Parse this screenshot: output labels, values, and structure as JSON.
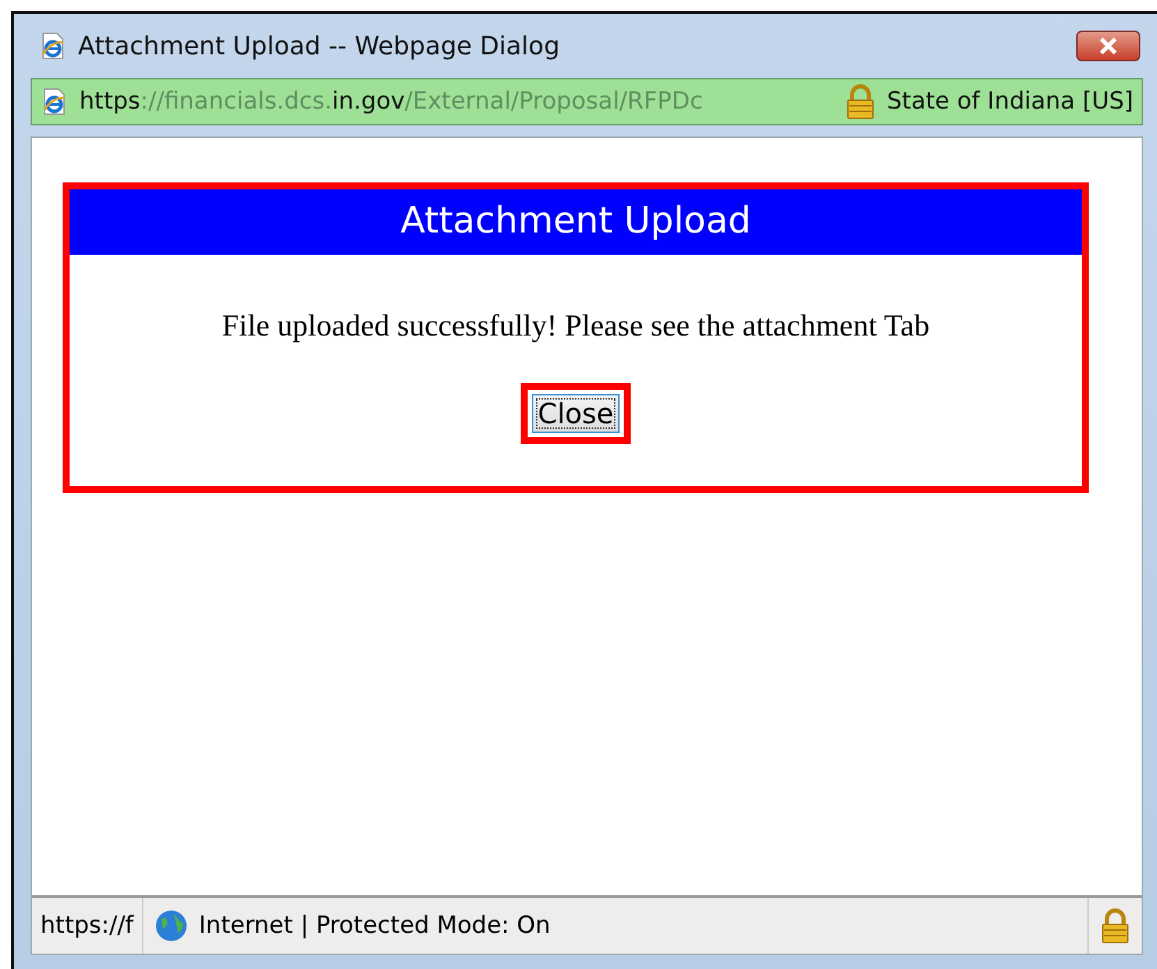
{
  "window": {
    "title": "Attachment Upload -- Webpage Dialog"
  },
  "address_bar": {
    "url_parts": [
      {
        "text": "https",
        "highlighted": true
      },
      {
        "text": "://financials.dcs.",
        "highlighted": false
      },
      {
        "text": "in.gov",
        "highlighted": true
      },
      {
        "text": "/External/Proposal/RFPDc",
        "highlighted": false
      }
    ],
    "certificate": "State of Indiana [US]"
  },
  "dialog": {
    "heading": "Attachment Upload",
    "message": "File uploaded successfully! Please see the attachment Tab",
    "button": "Close"
  },
  "status_bar": {
    "url": "https://f",
    "zone": "Internet | Protected Mode: On"
  }
}
